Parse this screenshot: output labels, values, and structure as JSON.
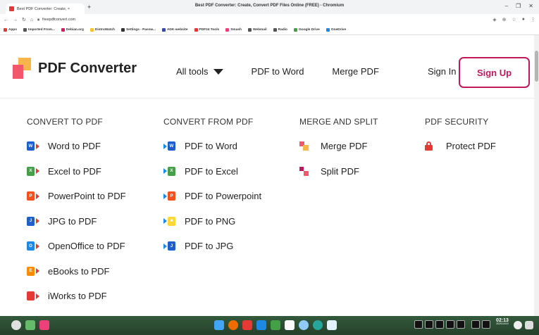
{
  "browser": {
    "window_title": "Best PDF Converter: Create, Convert PDF Files Online (FREE) - Chromium",
    "tab_title": "Best PDF Converter: Create, ×",
    "new_tab": "+",
    "url": "freepdfconvert.com",
    "controls": {
      "minimize": "–",
      "maximize": "❐",
      "close": "✕"
    },
    "bookmarks": [
      {
        "label": "Apps",
        "color": "#e53935"
      },
      {
        "label": "Imported From...",
        "color": "#555555"
      },
      {
        "label": "Debian.org",
        "color": "#d81b60"
      },
      {
        "label": "DistroWatch",
        "color": "#fbc02d"
      },
      {
        "label": "Settings - Passw...",
        "color": "#333333"
      },
      {
        "label": "ADK-website",
        "color": "#3949ab"
      },
      {
        "label": "PDF24 Tools",
        "color": "#e53935"
      },
      {
        "label": "Smash",
        "color": "#ec407a"
      },
      {
        "label": "Webmail",
        "color": "#555555"
      },
      {
        "label": "Radio",
        "color": "#555555"
      },
      {
        "label": "Google Drive",
        "color": "#43a047"
      },
      {
        "label": "OneDrive",
        "color": "#1e88e5"
      }
    ]
  },
  "header": {
    "logo_text": "PDF Converter",
    "nav": [
      {
        "label": "All tools",
        "dropdown": true
      },
      {
        "label": "PDF to Word",
        "dropdown": false
      },
      {
        "label": "Merge PDF",
        "dropdown": false
      }
    ],
    "sign_in": "Sign In",
    "sign_up": "Sign Up",
    "accent_color": "#c2185b"
  },
  "columns": [
    {
      "heading": "CONVERT TO PDF",
      "items": [
        {
          "label": "Word to PDF",
          "icon": "word-icon",
          "color": "#1e5fc9",
          "letter": "W"
        },
        {
          "label": "Excel to PDF",
          "icon": "excel-icon",
          "color": "#43a047",
          "letter": "X"
        },
        {
          "label": "PowerPoint to PDF",
          "icon": "powerpoint-icon",
          "color": "#f4511e",
          "letter": "P"
        },
        {
          "label": "JPG to PDF",
          "icon": "jpg-icon",
          "color": "#1e5fc9",
          "letter": "J"
        },
        {
          "label": "OpenOffice to PDF",
          "icon": "openoffice-icon",
          "color": "#1e88e5",
          "letter": "O"
        },
        {
          "label": "eBooks to PDF",
          "icon": "ebook-icon",
          "color": "#fb8c00",
          "letter": "E"
        },
        {
          "label": "iWorks to PDF",
          "icon": "iworks-icon",
          "color": "#e53935",
          "letter": ""
        }
      ]
    },
    {
      "heading": "CONVERT FROM PDF",
      "items": [
        {
          "label": "PDF to Word",
          "icon": "word-icon",
          "color": "#1e5fc9",
          "letter": "W"
        },
        {
          "label": "PDF to Excel",
          "icon": "excel-icon",
          "color": "#43a047",
          "letter": "X"
        },
        {
          "label": "PDF to Powerpoint",
          "icon": "powerpoint-icon",
          "color": "#f4511e",
          "letter": "P"
        },
        {
          "label": "PDF to PNG",
          "icon": "png-icon",
          "color": "#fdd835",
          "letter": "■"
        },
        {
          "label": "PDF to JPG",
          "icon": "jpg-icon",
          "color": "#1e5fc9",
          "letter": "J"
        }
      ]
    },
    {
      "heading": "MERGE AND SPLIT",
      "items": [
        {
          "label": "Merge PDF",
          "icon": "merge-icon"
        },
        {
          "label": "Split PDF",
          "icon": "split-icon"
        }
      ]
    },
    {
      "heading": "PDF SECURITY",
      "items": [
        {
          "label": "Protect PDF",
          "icon": "lock-icon"
        }
      ]
    }
  ],
  "taskbar": {
    "clock_time": "02:13",
    "clock_date": "2020/10/10"
  }
}
